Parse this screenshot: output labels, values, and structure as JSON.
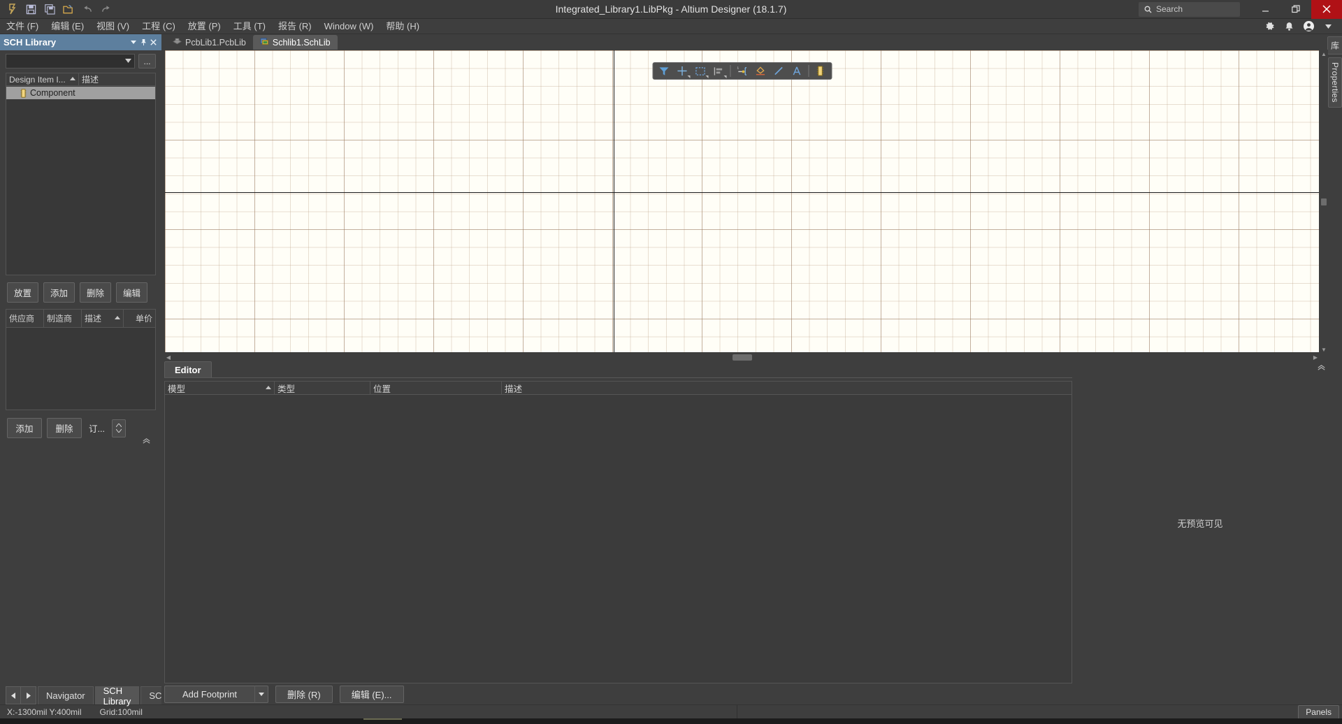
{
  "titlebar": {
    "title": "Integrated_Library1.LibPkg - Altium Designer (18.1.7)",
    "search_placeholder": "Search",
    "quick_access": [
      {
        "name": "altium-logo-icon",
        "label": "A"
      },
      {
        "name": "save-icon",
        "label": "Save"
      },
      {
        "name": "save-all-icon",
        "label": "Save All"
      },
      {
        "name": "open-folder-icon",
        "label": "Open"
      },
      {
        "name": "undo-icon",
        "label": "Undo"
      },
      {
        "name": "redo-icon",
        "label": "Redo"
      }
    ],
    "window_controls": {
      "minimize": "—",
      "restore": "❐",
      "close": "✕"
    }
  },
  "menubar": {
    "items": [
      {
        "text": "文件 (F)",
        "mnemonic": "F"
      },
      {
        "text": "编辑 (E)",
        "mnemonic": "E"
      },
      {
        "text": "视图 (V)",
        "mnemonic": "V"
      },
      {
        "text": "工程 (C)",
        "mnemonic": "C"
      },
      {
        "text": "放置 (P)",
        "mnemonic": "P"
      },
      {
        "text": "工具 (T)",
        "mnemonic": "T"
      },
      {
        "text": "报告 (R)",
        "mnemonic": "R"
      },
      {
        "text": "Window (W)",
        "mnemonic": "W"
      },
      {
        "text": "帮助 (H)",
        "mnemonic": "H"
      }
    ],
    "right_icons": [
      "gear-icon",
      "notification-bell-icon",
      "user-account-icon",
      "chevron-down-icon"
    ]
  },
  "sch_library_panel": {
    "title": "SCH Library",
    "title_buttons": [
      "chevron-down-icon",
      "pin-icon",
      "close-icon"
    ],
    "library_select_value": "",
    "browse_button": "...",
    "tree_columns": [
      {
        "label": "Design Item I...",
        "sorted": true
      },
      {
        "label": "描述",
        "sorted": false
      }
    ],
    "tree_rows": [
      {
        "label": "Component",
        "selected": true,
        "icon": "component-icon"
      }
    ],
    "component_buttons": [
      {
        "label": "放置"
      },
      {
        "label": "添加"
      },
      {
        "label": "删除"
      },
      {
        "label": "编辑"
      }
    ],
    "supplier_columns": [
      "供应商",
      "制造商",
      "描述",
      "单价"
    ],
    "supplier_sorted_column": "描述",
    "supplier_rows": [],
    "supplier_buttons": [
      {
        "label": "添加"
      },
      {
        "label": "删除"
      },
      {
        "label": "订..."
      }
    ],
    "bottom_tabs": [
      {
        "label": "Navigator",
        "active": false
      },
      {
        "label": "SCH Library",
        "active": true
      },
      {
        "label": "SCHLIB",
        "active": false
      }
    ],
    "nav_arrows": {
      "prev": "◀",
      "next": "▶"
    }
  },
  "document_tabs": [
    {
      "label": "PcbLib1.PcbLib",
      "icon": "pcblib-icon",
      "active": false
    },
    {
      "label": "Schlib1.SchLib",
      "icon": "schlib-icon",
      "active": true
    }
  ],
  "floating_toolbar": {
    "buttons": [
      {
        "name": "filter-icon",
        "dropdown": false
      },
      {
        "name": "crosshair-place-icon",
        "dropdown": true
      },
      {
        "name": "rectangle-select-icon",
        "dropdown": true
      },
      {
        "name": "align-icon",
        "dropdown": true
      },
      {
        "name": "place-pin-icon",
        "dropdown": false
      },
      {
        "name": "place-polygon-icon",
        "dropdown": false
      },
      {
        "name": "place-line-icon",
        "dropdown": false
      },
      {
        "name": "place-text-icon",
        "dropdown": false
      },
      {
        "name": "place-component-icon",
        "dropdown": false
      }
    ]
  },
  "editor_panel": {
    "tabs": [
      {
        "label": "Editor",
        "active": true
      }
    ],
    "model_columns": [
      {
        "label": "模型",
        "sorted": true
      },
      {
        "label": "类型",
        "sorted": false
      },
      {
        "label": "位置",
        "sorted": false
      },
      {
        "label": "描述",
        "sorted": false
      }
    ],
    "model_rows": [],
    "preview_text": "无预览可见",
    "footer_buttons": [
      {
        "label": "Add Footprint",
        "mnemonic": "A",
        "has_dropdown": true
      },
      {
        "label": "删除 (R)",
        "mnemonic": "R",
        "has_dropdown": false
      },
      {
        "label": "编辑 (E)...",
        "mnemonic": "E",
        "has_dropdown": false
      }
    ]
  },
  "right_dock": {
    "tabs": [
      {
        "label": "库"
      },
      {
        "label": "Properties"
      }
    ]
  },
  "statusbar": {
    "coordinates": "X:-1300mil Y:400mil",
    "grid": "Grid:100mil",
    "panels_button": "Panels"
  },
  "colors": {
    "accent_panel_title": "#5d7f9e",
    "window_bg": "#3e3e3e",
    "canvas_bg": "#fffef7",
    "close_red": "#b01116",
    "selection_gray": "#9b9b9b"
  }
}
